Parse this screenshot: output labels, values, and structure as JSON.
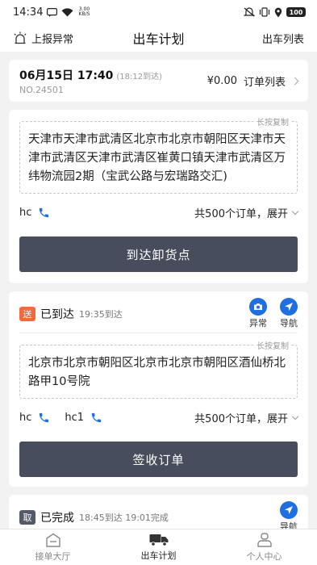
{
  "status_bar": {
    "time": "14:34",
    "net_speed_value": "3.00",
    "net_speed_unit": "KB/S",
    "battery": "100"
  },
  "nav": {
    "left_label": "上报异常",
    "title": "出车计划",
    "right_label": "出车列表"
  },
  "plan": {
    "date": "06月15日 17:40",
    "date_note": "(18:12到达)",
    "number": "NO.24501",
    "amount": "¥0.00",
    "order_list_label": "订单列表"
  },
  "stops": [
    {
      "copy_hint": "长按复制",
      "address": "天津市天津市武清区北京市北京市朝阳区天津市天津市武清区天津市武清区崔黄口镇天津市武清区万纬物流园2期（宝武公路与宏瑞路交汇)",
      "contacts": [
        "hc"
      ],
      "orders_text": "共500个订单，展开",
      "button_label": "到达卸货点"
    },
    {
      "tag": "送",
      "status": "已到达",
      "time": "19:35到达",
      "action_exception": "异常",
      "action_nav": "导航",
      "copy_hint": "长按复制",
      "address": "北京市北京市朝阳区北京市北京市朝阳区酒仙桥北路甲10号院",
      "contacts": [
        "hc",
        "hc1"
      ],
      "orders_text": "共500个订单，展开",
      "button_label": "签收订单"
    },
    {
      "tag": "取",
      "status": "已完成",
      "time": "18:45到达 19:01完成",
      "action_nav": "导航"
    }
  ],
  "tabs": [
    {
      "label": "接单大厅",
      "icon": "hall-icon"
    },
    {
      "label": "出车计划",
      "icon": "truck-icon"
    },
    {
      "label": "个人中心",
      "icon": "user-icon"
    }
  ],
  "colors": {
    "accent_blue": "#1f6fe0",
    "button_dark": "#474d5c",
    "tag_orange": "#f36a3a",
    "tag_gray": "#555a68"
  }
}
